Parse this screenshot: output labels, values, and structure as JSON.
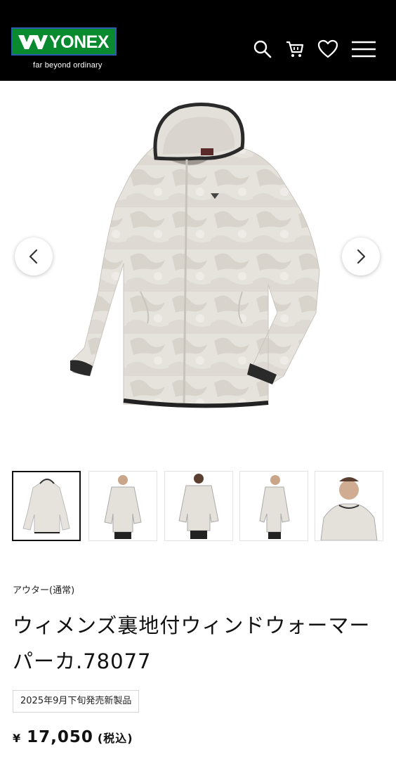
{
  "header": {
    "brand": "YONEX",
    "tagline": "far beyond ordinary",
    "icons": [
      "search-icon",
      "cart-icon",
      "heart-icon",
      "menu-icon"
    ]
  },
  "gallery": {
    "prev_icon": "chevron-left-icon",
    "next_icon": "chevron-right-icon"
  },
  "product": {
    "category": "アウター(通常)",
    "title": "ウィメンズ裏地付ウィンドウォーマーパーカ.78077",
    "badge": "2025年9月下旬発売新製品",
    "price_symbol": "¥",
    "price": "17,050",
    "tax_note": "(税込)"
  },
  "colors": {
    "header_bg": "#000000",
    "logo_green": "#0a8a2e",
    "logo_border": "#2a5db0"
  }
}
